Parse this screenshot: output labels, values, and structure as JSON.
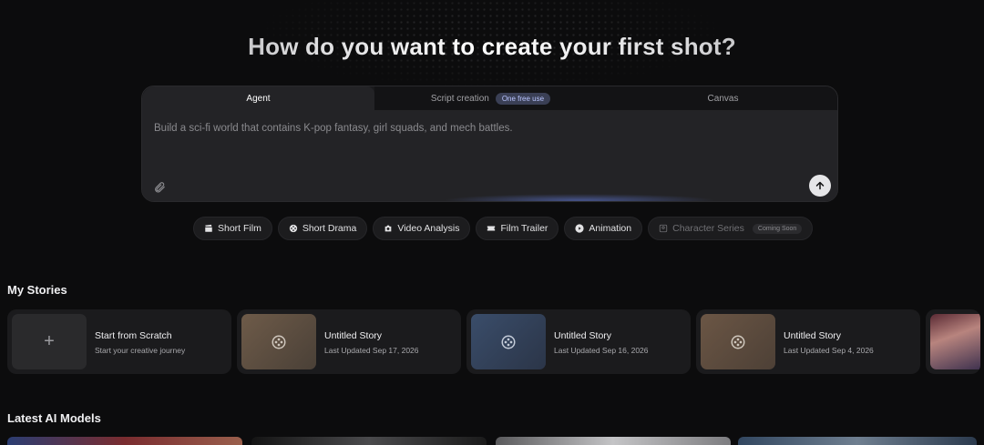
{
  "headline": "How do you want to create your first shot?",
  "prompt_card": {
    "tabs": [
      {
        "label": "Agent",
        "active": true
      },
      {
        "label": "Script creation",
        "badge": "One free use",
        "active": false
      },
      {
        "label": "Canvas",
        "active": false
      }
    ],
    "placeholder": "Build a sci-fi world that contains K-pop fantasy, girl squads, and mech battles.",
    "attach_icon": "paperclip-icon",
    "send_icon": "arrow-up-icon"
  },
  "chips": [
    {
      "label": "Short Film",
      "icon": "clapper-icon"
    },
    {
      "label": "Short Drama",
      "icon": "film-reel-icon"
    },
    {
      "label": "Video Analysis",
      "icon": "camera-icon"
    },
    {
      "label": "Film Trailer",
      "icon": "ticket-icon"
    },
    {
      "label": "Animation",
      "icon": "play-icon"
    },
    {
      "label": "Character Series",
      "icon": "character-icon",
      "badge": "Coming Soon",
      "disabled": true
    }
  ],
  "my_stories": {
    "title": "My Stories",
    "items": [
      {
        "title": "Start from Scratch",
        "subtitle": "Start your creative journey",
        "icon": "plus-icon"
      },
      {
        "title": "Untitled Story",
        "subtitle": "Last Updated Sep 17, 2026",
        "icon": "film-reel-icon"
      },
      {
        "title": "Untitled Story",
        "subtitle": "Last Updated Sep 16, 2026",
        "icon": "film-reel-icon"
      },
      {
        "title": "Untitled Story",
        "subtitle": "Last Updated Sep 4, 2026",
        "icon": "film-reel-icon"
      }
    ]
  },
  "latest_models": {
    "title": "Latest AI Models"
  },
  "colors": {
    "background": "#0c0c0d",
    "card": "#1b1b1d",
    "badge_bg": "#3a3f55",
    "badge_text": "#b9c4ff"
  }
}
